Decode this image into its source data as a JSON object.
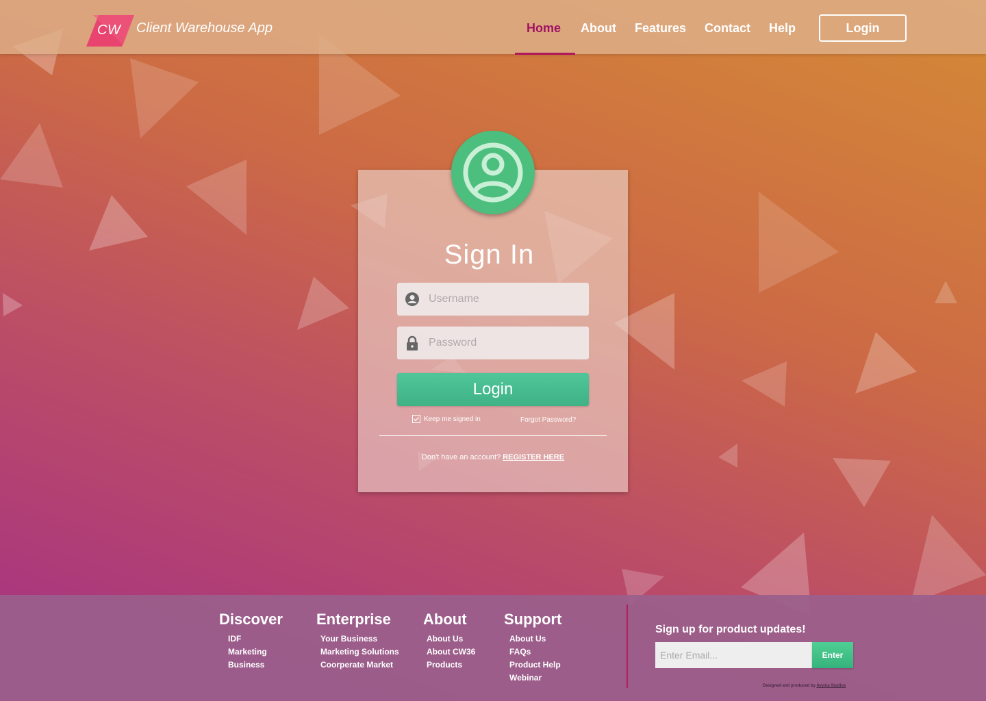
{
  "header": {
    "logo_text": "CW",
    "app_title": "Client Warehouse App",
    "nav": [
      {
        "label": "Home",
        "active": true
      },
      {
        "label": "About"
      },
      {
        "label": "Features"
      },
      {
        "label": "Contact"
      },
      {
        "label": "Help"
      }
    ],
    "login_label": "Login"
  },
  "signin": {
    "title": "Sign In",
    "username_placeholder": "Username",
    "password_placeholder": "Password",
    "login_label": "Login",
    "keep_signed_in": "Keep me signed in",
    "keep_signed_in_checked": true,
    "forgot_password": "Forgot Password?",
    "no_account_text": "Don't have an account?",
    "register_label": "REGISTER HERE"
  },
  "footer": {
    "columns": [
      {
        "title": "Discover",
        "items": [
          "IDF",
          "Marketing",
          "Business"
        ]
      },
      {
        "title": "Enterprise",
        "items": [
          "Your Business",
          "Marketing Solutions",
          "Coorperate Market"
        ]
      },
      {
        "title": "About",
        "items": [
          "About Us",
          "About CW36",
          "Products"
        ]
      },
      {
        "title": "Support",
        "items": [
          "About Us",
          "FAQs",
          "Product Help",
          "Webinar"
        ]
      }
    ],
    "signup_title": "Sign up for product updates!",
    "email_placeholder": "Enter Email...",
    "enter_label": "Enter",
    "credit_prefix": "Designed and produced by",
    "credit_studio": "Avyxia Studios"
  },
  "colors": {
    "accent_green": "#4cbe7d",
    "active_nav": "#a01363",
    "logo_pink": "#e8446f",
    "divider_magenta": "#b0205f"
  },
  "icons": {
    "avatar": "user-circle-icon",
    "username": "user-icon",
    "password": "lock-icon",
    "checkbox": "check-icon"
  }
}
